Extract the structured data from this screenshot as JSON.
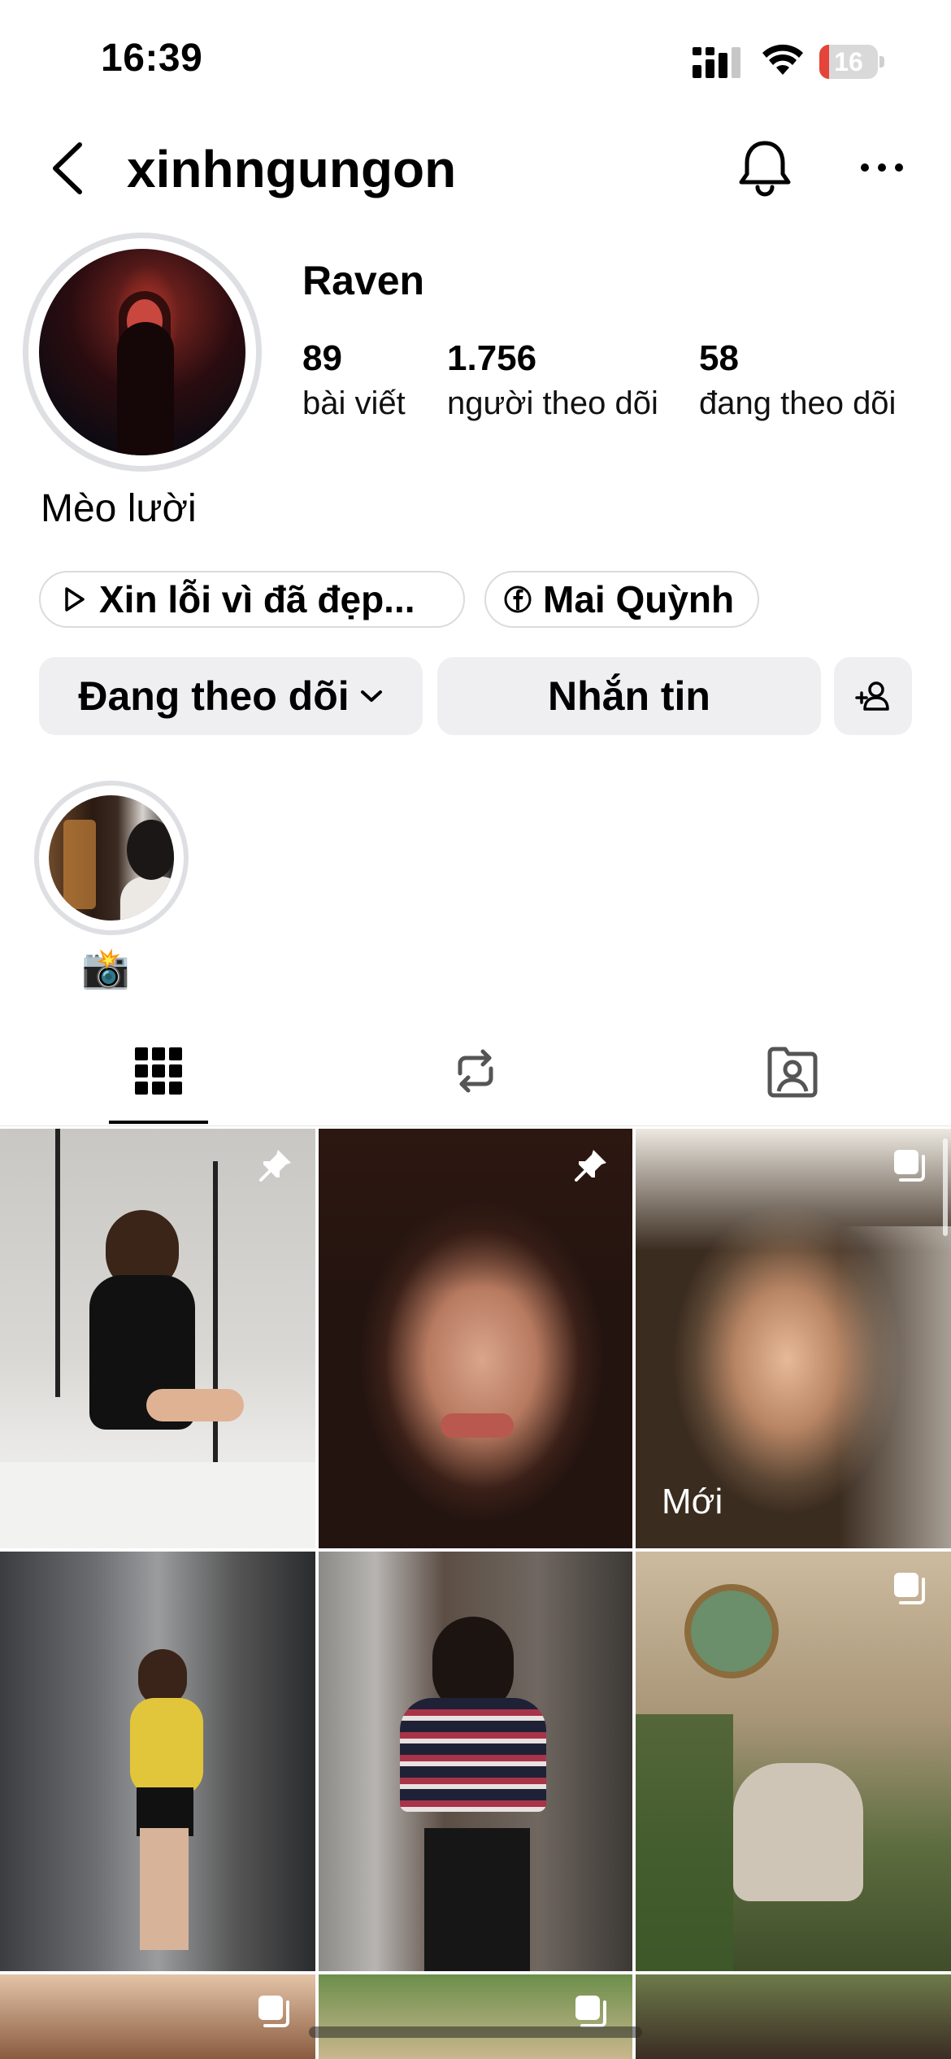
{
  "status_bar": {
    "time": "16:39",
    "battery": "16",
    "battery_level": 0.16
  },
  "header": {
    "username": "xinhngungon"
  },
  "profile": {
    "display_name": "Raven",
    "stats": [
      {
        "value": "89",
        "label": "bài viết"
      },
      {
        "value": "1.756",
        "label": "người theo dõi"
      },
      {
        "value": "58",
        "label": "đang theo dõi"
      }
    ],
    "bio": "Mèo lười",
    "links": [
      {
        "icon": "play-icon",
        "label": "Xin lỗi vì đã đẹp..."
      },
      {
        "icon": "facebook-icon",
        "label": "Mai Quỳnh"
      }
    ]
  },
  "actions": {
    "follow_label": "Đang theo dõi",
    "message_label": "Nhắn tin"
  },
  "highlights": [
    {
      "label": "📸"
    }
  ],
  "tabs": [
    {
      "name": "posts-grid",
      "icon": "grid-icon",
      "active": true
    },
    {
      "name": "reposts",
      "icon": "repost-icon",
      "active": false
    },
    {
      "name": "tagged",
      "icon": "tagged-person-icon",
      "active": false
    }
  ],
  "grid": {
    "tiles": [
      {
        "pinned": true
      },
      {
        "pinned": true
      },
      {
        "badge": "multiple-icon",
        "label": "Mới"
      },
      {},
      {},
      {
        "badge": "multiple-icon"
      },
      {
        "badge": "multiple-icon"
      },
      {
        "badge": "multiple-icon"
      },
      {}
    ]
  },
  "colors": {
    "button_bg": "#efeff2",
    "ring": "#dedfe2",
    "text": "#000000",
    "battery_red": "#e5443b"
  }
}
